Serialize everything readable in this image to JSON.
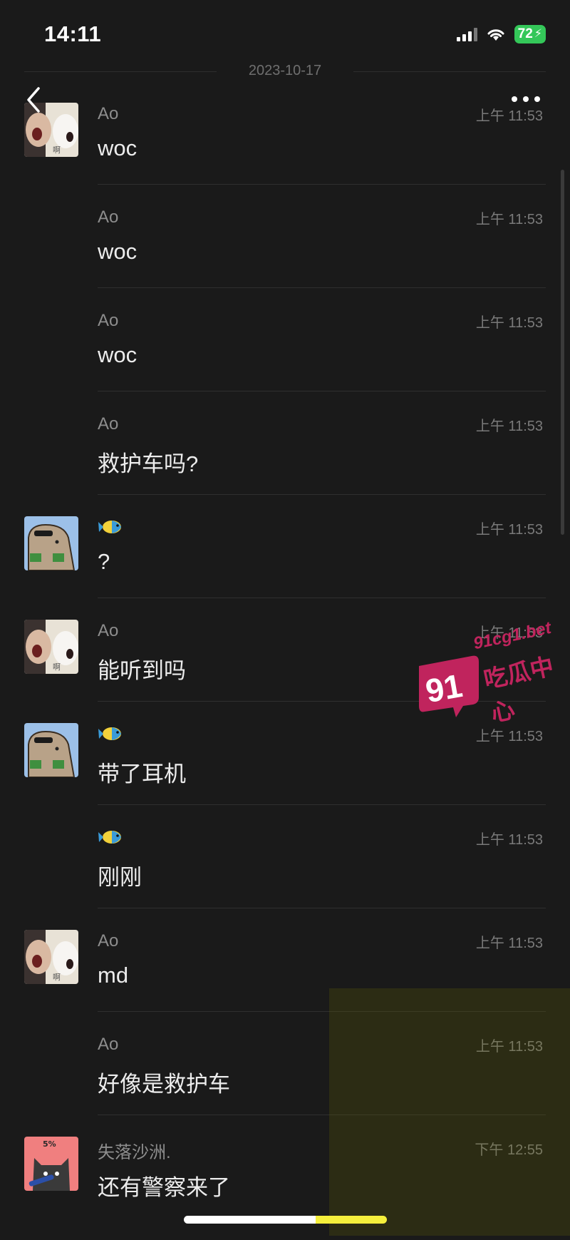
{
  "status_bar": {
    "time": "14:11",
    "battery": "72"
  },
  "date_separator": "2023-10-17",
  "messages": [
    {
      "sender": "Ao",
      "time": "上午 11:53",
      "text": "woc",
      "avatar": "ao"
    },
    {
      "sender": "Ao",
      "time": "上午 11:53",
      "text": "woc",
      "avatar": ""
    },
    {
      "sender": "Ao",
      "time": "上午 11:53",
      "text": "woc",
      "avatar": ""
    },
    {
      "sender": "Ao",
      "time": "上午 11:53",
      "text": "救护车吗?",
      "avatar": ""
    },
    {
      "sender": "",
      "time": "上午 11:53",
      "text": "?",
      "avatar": "capybara"
    },
    {
      "sender": "Ao",
      "time": "上午 11:53",
      "text": "能听到吗",
      "avatar": "ao"
    },
    {
      "sender": "",
      "time": "上午 11:53",
      "text": "带了耳机",
      "avatar": "capybara"
    },
    {
      "sender": "",
      "time": "上午 11:53",
      "text": "刚刚",
      "avatar": ""
    },
    {
      "sender": "Ao",
      "time": "上午 11:53",
      "text": "md",
      "avatar": "ao"
    },
    {
      "sender": "Ao",
      "time": "上午 11:53",
      "text": "好像是救护车",
      "avatar": ""
    },
    {
      "sender": "失落沙洲.",
      "time": "下午 12:55",
      "text": "还有警察来了",
      "avatar": "cat"
    }
  ],
  "avatar_texts": {
    "ao": "啊",
    "cat": "5%"
  },
  "watermark": {
    "number": "91",
    "site": "91cg1.bet",
    "label": "吃瓜中心"
  },
  "colors": {
    "background": "#1a1a1a",
    "battery": "#34c759",
    "watermark": "#c0245d"
  }
}
